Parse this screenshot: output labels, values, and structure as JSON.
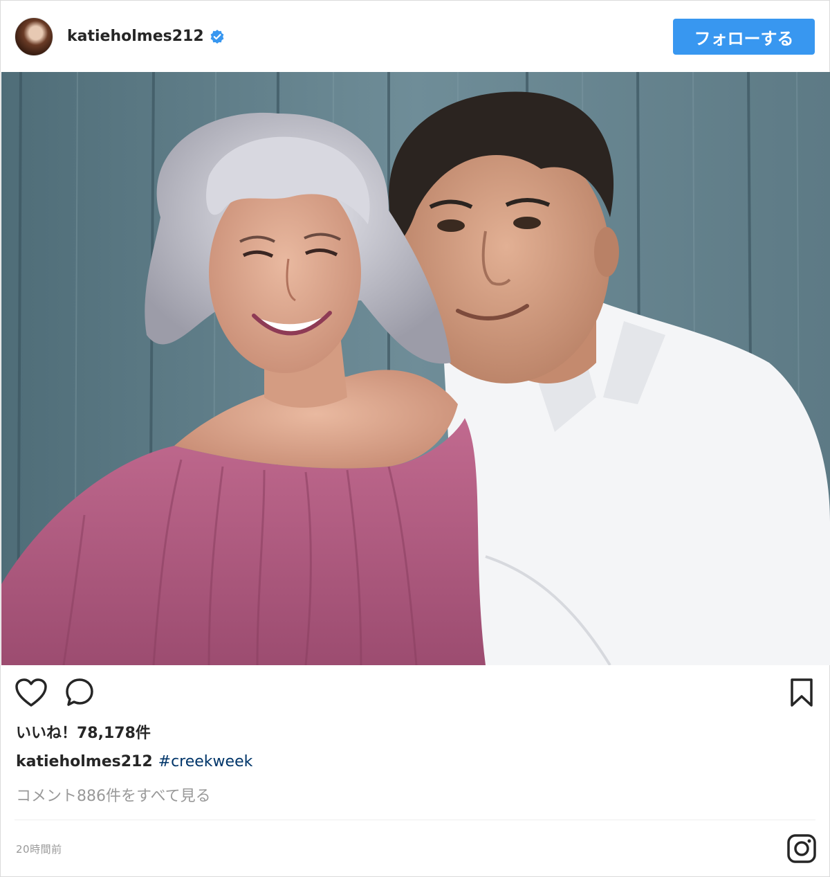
{
  "header": {
    "username": "katieholmes212",
    "follow_label": "フォローする",
    "verified_icon": "verified-badge-icon"
  },
  "photo": {
    "icon": "photo"
  },
  "actions": {
    "like_icon": "heart-outline-icon",
    "comment_icon": "speech-bubble-icon",
    "save_icon": "bookmark-icon"
  },
  "likes": {
    "text": "いいね！78,178件"
  },
  "caption": {
    "username": "katieholmes212",
    "hashtag": "#creekweek"
  },
  "comments": {
    "view_all": "コメント886件をすべて見る"
  },
  "timestamp": "20時間前",
  "footer": {
    "logo_icon": "instagram-logo-icon"
  },
  "colors": {
    "follow_button": "#3897f0",
    "hashtag": "#003569",
    "muted_text": "#999999",
    "verified_badge": "#3897f0"
  }
}
